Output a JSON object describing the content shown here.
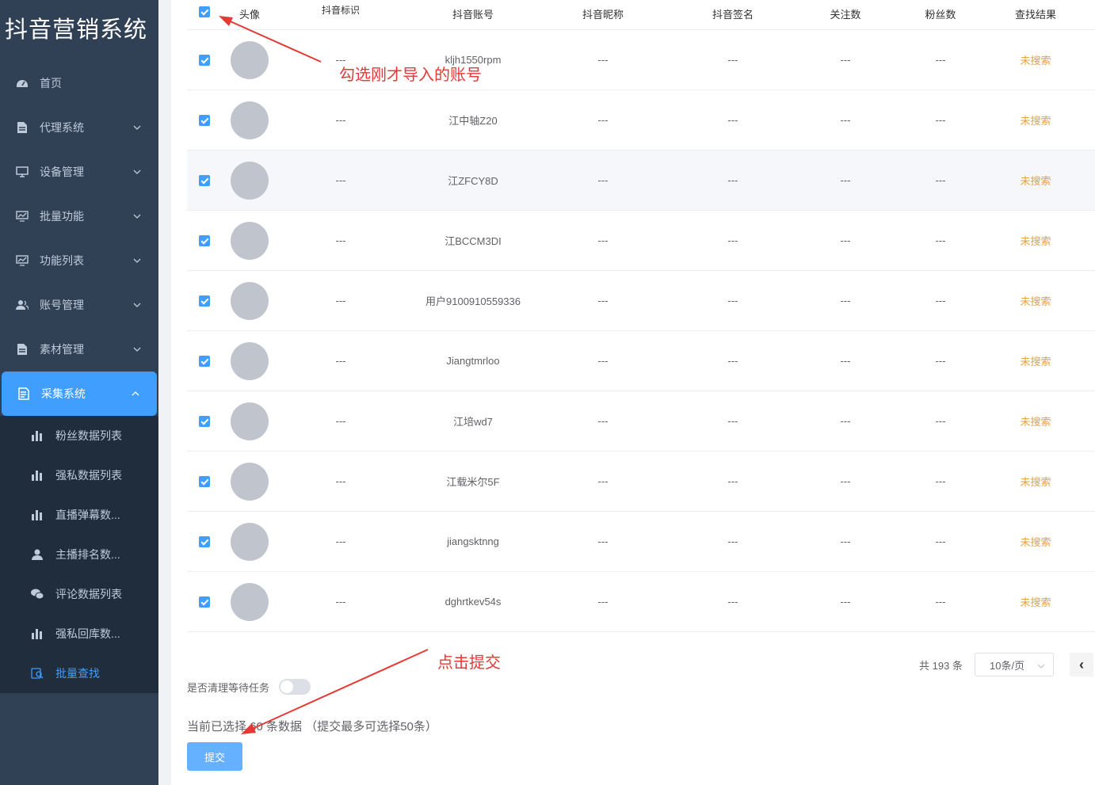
{
  "app": {
    "title": "抖音营销系统"
  },
  "sidebar": {
    "items": [
      {
        "label": "首页",
        "icon": "dashboard-icon",
        "has_children": false
      },
      {
        "label": "代理系统",
        "icon": "document-icon",
        "has_children": true
      },
      {
        "label": "设备管理",
        "icon": "monitor-icon",
        "has_children": true
      },
      {
        "label": "批量功能",
        "icon": "screen-chart-icon",
        "has_children": true
      },
      {
        "label": "功能列表",
        "icon": "screen-chart-icon",
        "has_children": true
      },
      {
        "label": "账号管理",
        "icon": "user-group-icon",
        "has_children": true
      },
      {
        "label": "素材管理",
        "icon": "document-icon",
        "has_children": true
      },
      {
        "label": "采集系统",
        "icon": "collect-icon",
        "has_children": true,
        "expanded": true,
        "active": true
      }
    ],
    "sub_items": [
      {
        "label": "粉丝数据列表",
        "icon": "bar-chart-icon"
      },
      {
        "label": "强私数据列表",
        "icon": "bar-chart-icon"
      },
      {
        "label": "直播弹幕数...",
        "icon": "bar-chart-icon"
      },
      {
        "label": "主播排名数...",
        "icon": "user-icon"
      },
      {
        "label": "评论数据列表",
        "icon": "wechat-icon"
      },
      {
        "label": "强私回库数...",
        "icon": "bar-chart-icon"
      },
      {
        "label": "批量查找",
        "icon": "search-doc-icon",
        "current": true
      }
    ]
  },
  "table": {
    "headers": [
      "头像",
      "抖音标识",
      "抖音账号",
      "抖音昵称",
      "抖音签名",
      "关注数",
      "粉丝数",
      "查找结果"
    ],
    "rows": [
      {
        "account": "kljh1550rpm",
        "mark": "---",
        "nickname": "---",
        "signature": "---",
        "follows": "---",
        "fans": "---",
        "result": "未搜索"
      },
      {
        "account": "江中轴Z20",
        "mark": "---",
        "nickname": "---",
        "signature": "---",
        "follows": "---",
        "fans": "---",
        "result": "未搜索"
      },
      {
        "account": "江ZFCY8D",
        "mark": "---",
        "nickname": "---",
        "signature": "---",
        "follows": "---",
        "fans": "---",
        "result": "未搜索"
      },
      {
        "account": "江BCCM3DI",
        "mark": "---",
        "nickname": "---",
        "signature": "---",
        "follows": "---",
        "fans": "---",
        "result": "未搜索"
      },
      {
        "account": "用户9100910559336",
        "mark": "---",
        "nickname": "---",
        "signature": "---",
        "follows": "---",
        "fans": "---",
        "result": "未搜索"
      },
      {
        "account": "Jiangtmrloo",
        "mark": "---",
        "nickname": "---",
        "signature": "---",
        "follows": "---",
        "fans": "---",
        "result": "未搜索"
      },
      {
        "account": "江培wd7",
        "mark": "---",
        "nickname": "---",
        "signature": "---",
        "follows": "---",
        "fans": "---",
        "result": "未搜索"
      },
      {
        "account": "江载米尔5F",
        "mark": "---",
        "nickname": "---",
        "signature": "---",
        "follows": "---",
        "fans": "---",
        "result": "未搜索"
      },
      {
        "account": "jiangsktnng",
        "mark": "---",
        "nickname": "---",
        "signature": "---",
        "follows": "---",
        "fans": "---",
        "result": "未搜索"
      },
      {
        "account": "dghrtkev54s",
        "mark": "---",
        "nickname": "---",
        "signature": "---",
        "follows": "---",
        "fans": "---",
        "result": "未搜索"
      }
    ]
  },
  "pagination": {
    "total": "共 193 条",
    "page_size": "10条/页",
    "prev": "‹"
  },
  "options": {
    "clear_waiting_label": "是否清理等待任务",
    "clear_waiting_on": false
  },
  "selection": {
    "summary": "当前已选择 60 条数据 （提交最多可选择50条）"
  },
  "actions": {
    "submit_label": "提交"
  },
  "annotations": {
    "select_hint": "勾选刚才导入的账号",
    "submit_hint": "点击提交"
  },
  "colors": {
    "accent": "#409eff",
    "sidebar": "#304156",
    "status": "#e6a23c",
    "annotation": "#e53935"
  }
}
